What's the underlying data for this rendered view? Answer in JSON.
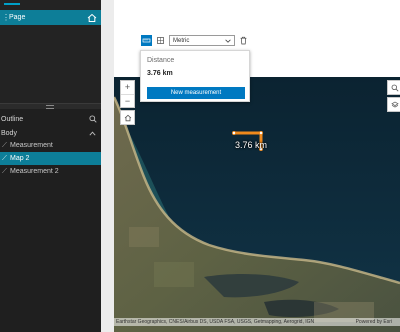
{
  "pages_panel": {
    "page_item_label": "Page"
  },
  "outline": {
    "title": "Outline",
    "body_label": "Body",
    "items": [
      {
        "label": "Measurement"
      },
      {
        "label": "Map 2"
      },
      {
        "label": "Measurement 2"
      }
    ]
  },
  "measurement": {
    "unit_value": "Metric",
    "distance_label": "Distance",
    "distance_value": "3.76 km",
    "new_button_label": "New measurement"
  },
  "map": {
    "measure_label": "3.76 km",
    "attribution": "Earthstar Geographics, CNES/Airbus DS, USDA FSA, USGS, Getmapping, Aerogrid, IGN",
    "powered_by": "Powered by Esri",
    "zoom_in": "+",
    "zoom_out": "−"
  },
  "colors": {
    "selection": "#0d7e98",
    "accent": "#0079c1",
    "measure_line": "#f08a1c"
  },
  "icons": [
    "home-icon",
    "search-icon",
    "chevron-up-icon",
    "chevron-down-icon",
    "distance-icon",
    "area-icon",
    "trash-icon",
    "layers-icon",
    "widget-icon"
  ]
}
